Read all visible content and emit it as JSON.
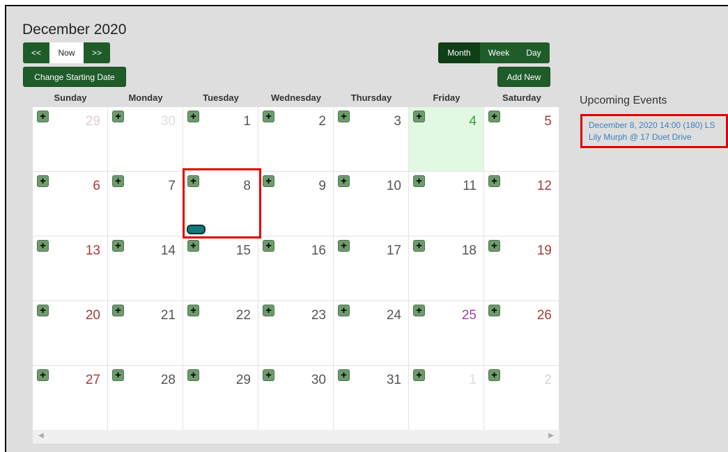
{
  "calendar": {
    "title": "December 2020",
    "nav": {
      "prev": "<<",
      "now": "Now",
      "next": ">>"
    },
    "change_start": "Change Starting Date",
    "views": {
      "month": "Month",
      "week": "Week",
      "day": "Day"
    },
    "active_view": "Month",
    "add_new": "Add New",
    "weekdays": [
      "Sunday",
      "Monday",
      "Tuesday",
      "Wednesday",
      "Thursday",
      "Friday",
      "Saturday"
    ],
    "weeks": [
      [
        "29",
        "30",
        "1",
        "2",
        "3",
        "4",
        "5"
      ],
      [
        "6",
        "7",
        "8",
        "9",
        "10",
        "11",
        "12"
      ],
      [
        "13",
        "14",
        "15",
        "16",
        "17",
        "18",
        "19"
      ],
      [
        "20",
        "21",
        "22",
        "23",
        "24",
        "25",
        "26"
      ],
      [
        "27",
        "28",
        "29",
        "30",
        "31",
        "1",
        "2"
      ]
    ],
    "add_glyph": "+",
    "today_date": "4",
    "event_on_date": "8"
  },
  "upcoming": {
    "title": "Upcoming Events",
    "events": [
      {
        "line1": "December 8, 2020 14:00 (180) LS",
        "line2": "Lily Murph @ 17 Duet Drive"
      }
    ]
  },
  "scrollbar": {
    "left_arrow": "◀",
    "right_arrow": "▶"
  },
  "colors": {
    "primary_green": "#1f5c2a",
    "today_bg": "#e3f8e3",
    "weekend_red": "#a83a3a",
    "holiday_purple": "#a045a8",
    "event_teal": "#127a78",
    "highlight_red": "#e00000",
    "link_blue": "#3b7fbf"
  }
}
